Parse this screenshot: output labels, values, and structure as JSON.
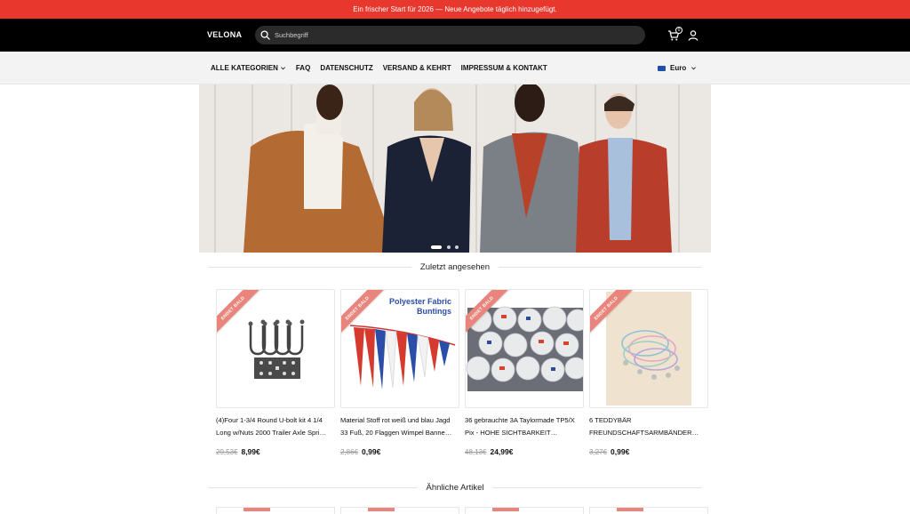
{
  "announcement": "Ein frischer Start für 2026 — Neue Angebote täglich hinzugefügt.",
  "header": {
    "logo": "VELONA",
    "search_placeholder": "Suchbegriff",
    "cart_count": "0",
    "icons": [
      "search-icon",
      "cart-icon",
      "user-icon"
    ]
  },
  "nav": {
    "items": [
      "ALLE KATEGORIEN",
      "FAQ",
      "DATENSCHUTZ",
      "VERSAND & KEHRT",
      "IMPRESSUM & KONTAKT"
    ],
    "currency": "Euro"
  },
  "hero": {
    "slide_count": 3,
    "active_slide": 1
  },
  "recent": {
    "title": "Zuletzt angesehen",
    "products": [
      {
        "ribbon": "ENDET BALD",
        "title": "(4)Four 1-3/4 Round U-bolt kit 4 1/4 Long w/Nuts 2000 Trailer Axle Spri…",
        "old_price": "29,53€",
        "price": "8,99€"
      },
      {
        "ribbon": "ENDET BALD",
        "image_caption": "Polyester Fabric Buntings",
        "title": "Material Stoff rot weiß und blau Jagd 33 Fuß, 20 Flaggen Wimpel Banne…",
        "old_price": "2,86€",
        "price": "0,99€"
      },
      {
        "ribbon": "ENDET BALD",
        "title": "36 gebrauchte 3A Taylormade TP5/X Pix - HOHE SICHTBARKEIT…",
        "old_price": "48,13€",
        "price": "24,99€"
      },
      {
        "ribbon": "ENDET BALD",
        "title": "6 TEDDYBÄR FREUNDSCHAFTSARMBÄNDER…",
        "old_price": "3,27€",
        "price": "0,99€"
      }
    ]
  },
  "similar": {
    "title": "Ähnliche Artikel"
  },
  "colors": {
    "announcement_bg": "#e8382e",
    "header_bg": "#000000",
    "nav_bg": "#f3f3f3",
    "ribbon": "#e9857d"
  }
}
